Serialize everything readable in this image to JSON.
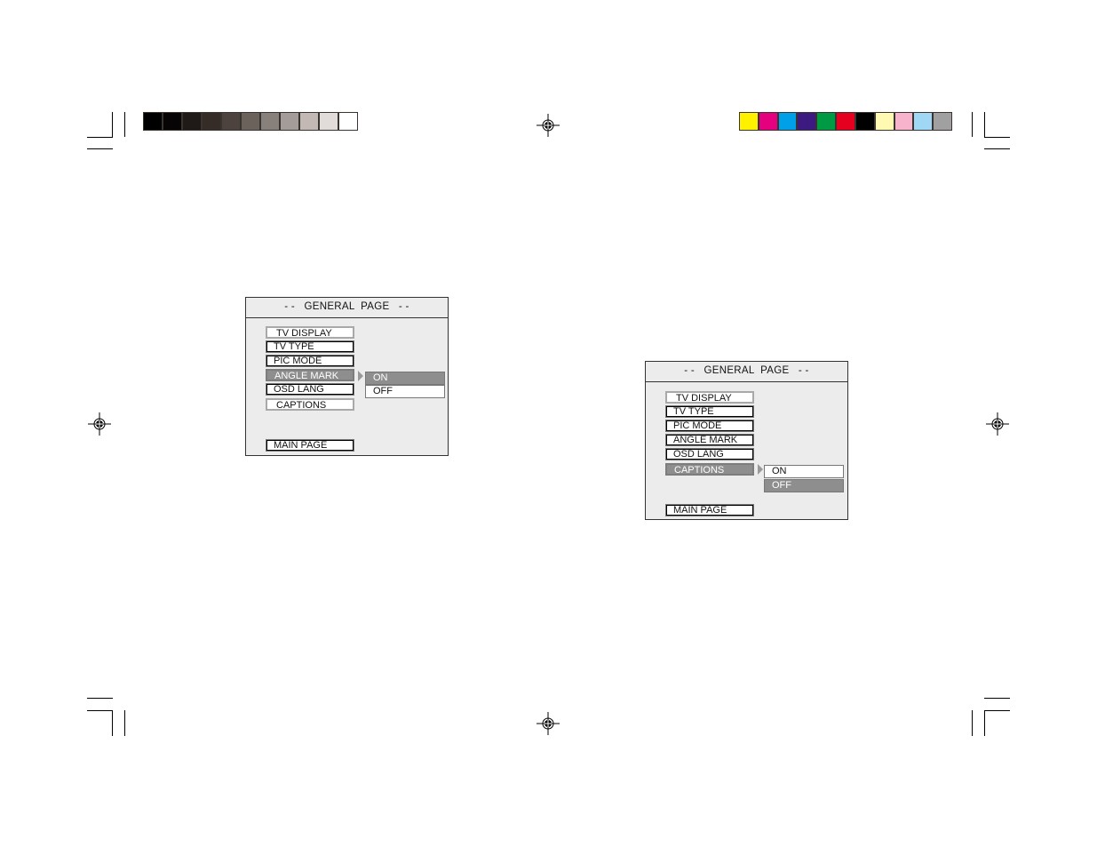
{
  "grayscale_bar": {
    "swatches": [
      "#000000",
      "#060405",
      "#1f1a17",
      "#352c28",
      "#4c433e",
      "#6b625c",
      "#88807b",
      "#a49c98",
      "#c2b9b5",
      "#e1dcd9",
      "#ffffff"
    ]
  },
  "color_bar": {
    "swatches": [
      "#fff100",
      "#e4007f",
      "#00a0e9",
      "#3c1a7f",
      "#009944",
      "#e60020",
      "#000000",
      "#fff9b1",
      "#f6b3cb",
      "#9fd7f4",
      "#a0a0a0"
    ]
  },
  "panels": [
    {
      "title": "- -   GENERAL  PAGE   - -",
      "items": [
        {
          "label": "TV DISPLAY",
          "style": "light"
        },
        {
          "label": "TV TYPE",
          "style": "dark"
        },
        {
          "label": "PIC MODE",
          "style": "dark"
        },
        {
          "label": "ANGLE MARK",
          "style": "sel"
        },
        {
          "label": "OSD LANG",
          "style": "dark"
        },
        {
          "label": "CAPTIONS",
          "style": "light"
        }
      ],
      "main_page": "MAIN PAGE",
      "submenu": [
        {
          "label": "ON",
          "selected": true
        },
        {
          "label": "OFF",
          "selected": false
        }
      ]
    },
    {
      "title": "- -   GENERAL  PAGE   - -",
      "items": [
        {
          "label": "TV DISPLAY",
          "style": "light"
        },
        {
          "label": "TV TYPE",
          "style": "dark"
        },
        {
          "label": "PIC MODE",
          "style": "dark"
        },
        {
          "label": "ANGLE MARK",
          "style": "dark"
        },
        {
          "label": "OSD LANG",
          "style": "dark"
        },
        {
          "label": "CAPTIONS",
          "style": "sel"
        }
      ],
      "main_page": "MAIN PAGE",
      "submenu": [
        {
          "label": "ON",
          "selected": false
        },
        {
          "label": "OFF",
          "selected": true
        }
      ]
    }
  ],
  "icons": {
    "registration_mark": "crosshair-target-icon",
    "crop_mark": "crop-mark-icon"
  }
}
